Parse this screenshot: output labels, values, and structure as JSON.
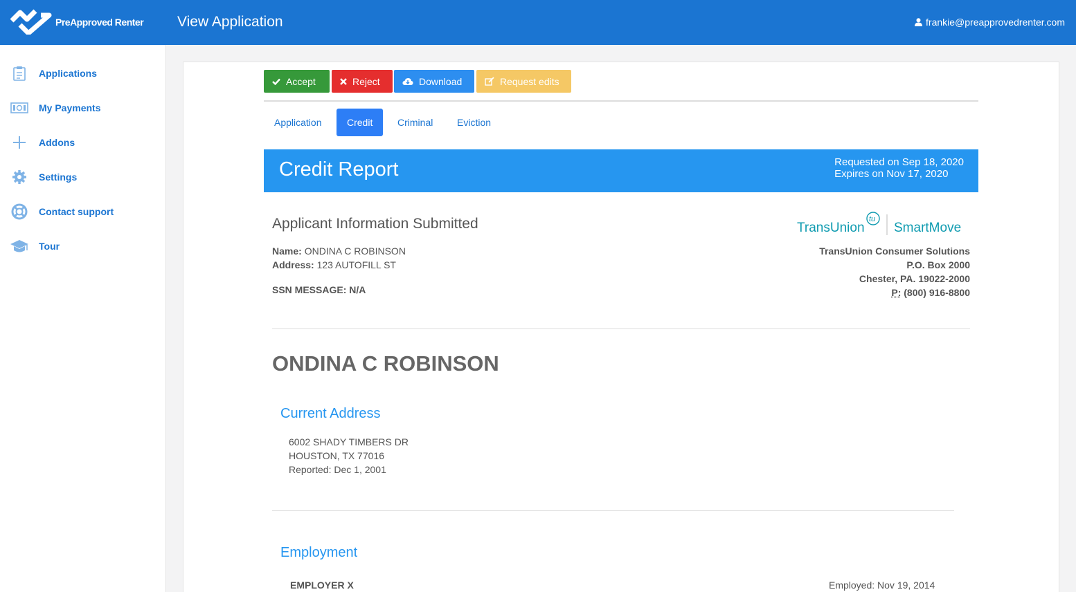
{
  "header": {
    "brand": "PreApproved Renter",
    "title": "View Application",
    "user_email": "frankie@preapprovedrenter.com"
  },
  "sidebar": {
    "items": [
      {
        "label": "Applications",
        "icon": "clipboard-icon"
      },
      {
        "label": "My Payments",
        "icon": "money-icon"
      },
      {
        "label": "Addons",
        "icon": "plus-icon"
      },
      {
        "label": "Settings",
        "icon": "gear-icon"
      },
      {
        "label": "Contact support",
        "icon": "lifebuoy-icon"
      },
      {
        "label": "Tour",
        "icon": "graduation-cap-icon"
      }
    ]
  },
  "actions": {
    "accept": "Accept",
    "reject": "Reject",
    "download": "Download",
    "request_edits": "Request edits"
  },
  "tabs": [
    {
      "label": "Application",
      "active": false
    },
    {
      "label": "Credit",
      "active": true
    },
    {
      "label": "Criminal",
      "active": false
    },
    {
      "label": "Eviction",
      "active": false
    }
  ],
  "banner": {
    "title": "Credit Report",
    "requested": "Requested on Sep 18, 2020",
    "expires": "Expires on Nov 17, 2020"
  },
  "applicant_info": {
    "heading": "Applicant Information Submitted",
    "name_label": "Name:",
    "name_value": "ONDINA C ROBINSON",
    "address_label": "Address:",
    "address_value": "123 AUTOFILL ST",
    "ssn_message": "SSN MESSAGE: N/A"
  },
  "bureau": {
    "logo_left": "TransUnion",
    "logo_badge": "tu",
    "logo_right": "SmartMove",
    "line1": "TransUnion Consumer Solutions",
    "line2": "P.O. Box 2000",
    "line3": "Chester, PA. 19022-2000",
    "phone_label": "P:",
    "phone": "(800) 916-8800"
  },
  "report": {
    "applicant_name": "ONDINA C ROBINSON",
    "current_address_heading": "Current Address",
    "address_line1": "6002 SHADY TIMBERS DR",
    "address_line2": "HOUSTON, TX 77016",
    "address_reported": "Reported: Dec 1, 2001",
    "employment_heading": "Employment",
    "employer": "EMPLOYER X",
    "employed": "Employed: Nov 19, 2014"
  },
  "colors": {
    "topbar": "#1b75d2",
    "accept": "#36993a",
    "reject": "#e52e2e",
    "download": "#2d8ef0",
    "request_edits": "#f5c865",
    "banner": "#2696f0",
    "transunion": "#0f9bb0"
  }
}
